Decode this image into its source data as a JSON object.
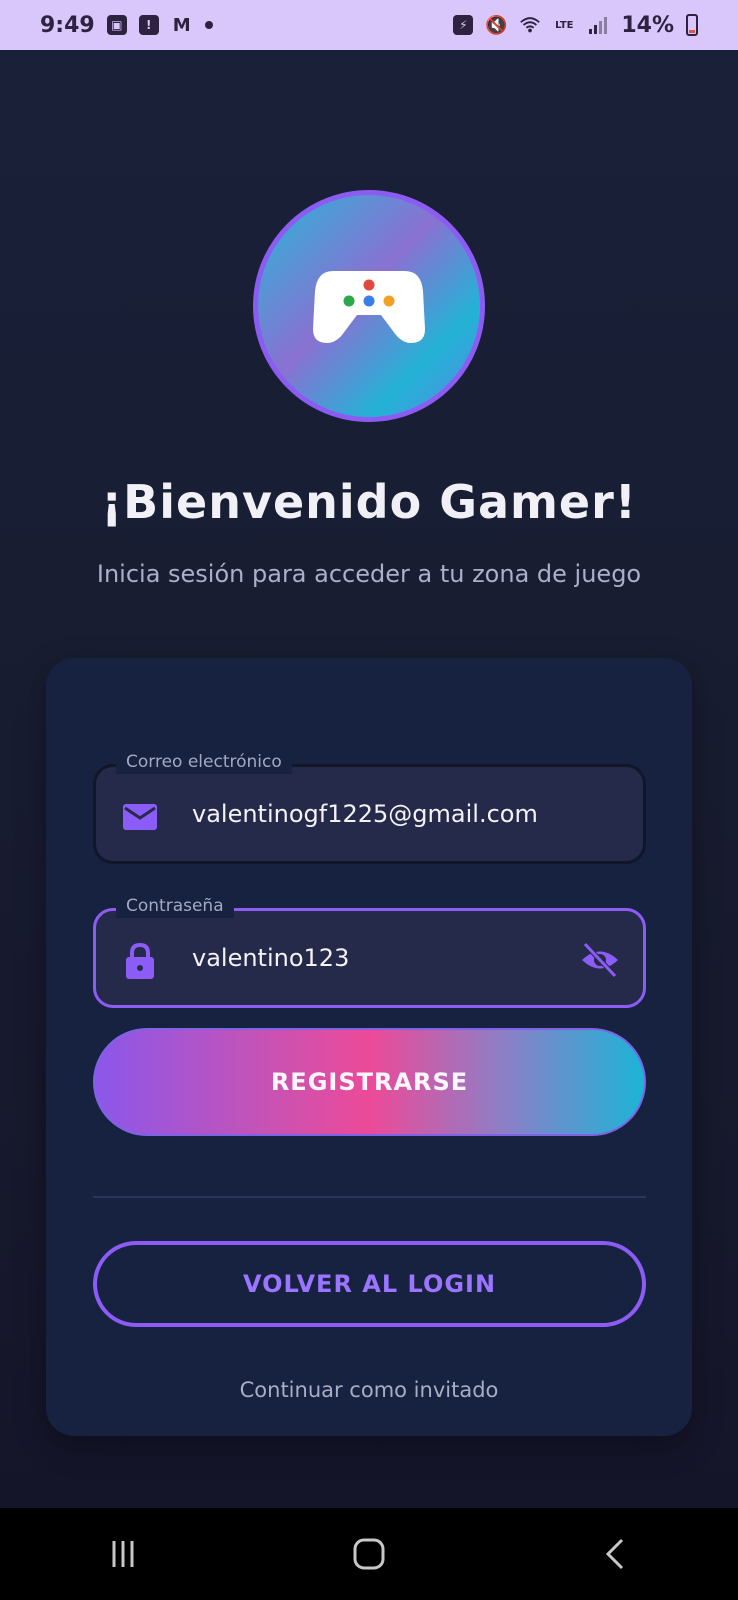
{
  "status_bar": {
    "time": "9:49",
    "battery": "14%"
  },
  "welcome": {
    "title": "¡Bienvenido Gamer!",
    "subtitle": "Inicia sesión para acceder a tu zona de juego"
  },
  "form": {
    "email": {
      "label": "Correo electrónico",
      "value": "valentinogf1225@gmail.com"
    },
    "password": {
      "label": "Contraseña",
      "value": "valentino123"
    },
    "register_label": "REGISTRARSE",
    "back_label": "VOLVER AL LOGIN",
    "guest_label": "Continuar como invitado"
  },
  "colors": {
    "accent": "#8b5cf6",
    "card": "#172241",
    "background": "#192038"
  },
  "icons": {
    "logo": "gamepad-icon",
    "email": "mail-icon",
    "password": "lock-icon",
    "visibility": "eye-off-icon"
  }
}
